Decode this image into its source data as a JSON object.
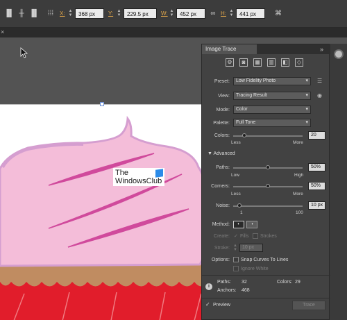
{
  "control_bar": {
    "x_label": "X:",
    "x_value": "368 px",
    "y_label": "Y:",
    "y_value": "229.5 px",
    "w_label": "W:",
    "w_value": "452 px",
    "h_label": "H:",
    "h_value": "441 px"
  },
  "doc_tab": {
    "close": "×"
  },
  "watermark": {
    "line1": "The",
    "line2": "WindowsClub"
  },
  "panel": {
    "title": "Image Trace",
    "collapse": "»",
    "preset_label": "Preset:",
    "preset_value": "Low Fidelity Photo",
    "view_label": "View:",
    "view_value": "Tracing Result",
    "mode_label": "Mode:",
    "mode_value": "Color",
    "palette_label": "Palette:",
    "palette_value": "Full Tone",
    "colors_label": "Colors:",
    "colors_value": "20",
    "colors_min": "Less",
    "colors_max": "More",
    "colors_level": 0.16,
    "advanced_label": "Advanced",
    "paths_label": "Paths:",
    "paths_value": "50%",
    "paths_min": "Low",
    "paths_max": "High",
    "paths_level": 0.5,
    "corners_label": "Corners:",
    "corners_value": "50%",
    "corners_min": "Less",
    "corners_max": "More",
    "corners_level": 0.5,
    "noise_label": "Noise:",
    "noise_value": "10 px",
    "noise_min": "1",
    "noise_max": "100",
    "noise_level": 0.09,
    "method_label": "Method:",
    "create_label": "Create:",
    "fills_label": "Fills",
    "strokes_label": "Strokes",
    "stroke_label": "Stroke:",
    "stroke_value": "10 px",
    "options_label": "Options:",
    "snap_label": "Snap Curves To Lines",
    "ignore_white_label": "Ignore White",
    "stats_paths_label": "Paths:",
    "stats_paths_value": "32",
    "stats_colors_label": "Colors:",
    "stats_colors_value": "29",
    "stats_anchors_label": "Anchors:",
    "stats_anchors_value": "468",
    "preview_label": "Preview",
    "trace_label": "Trace"
  },
  "colors": {
    "frosting": "#f4bdd9",
    "frosting_edge": "#d59ed0",
    "stripe": "#d04a9c",
    "cake": "#c08c61",
    "wrapper": "#e11d2b"
  }
}
